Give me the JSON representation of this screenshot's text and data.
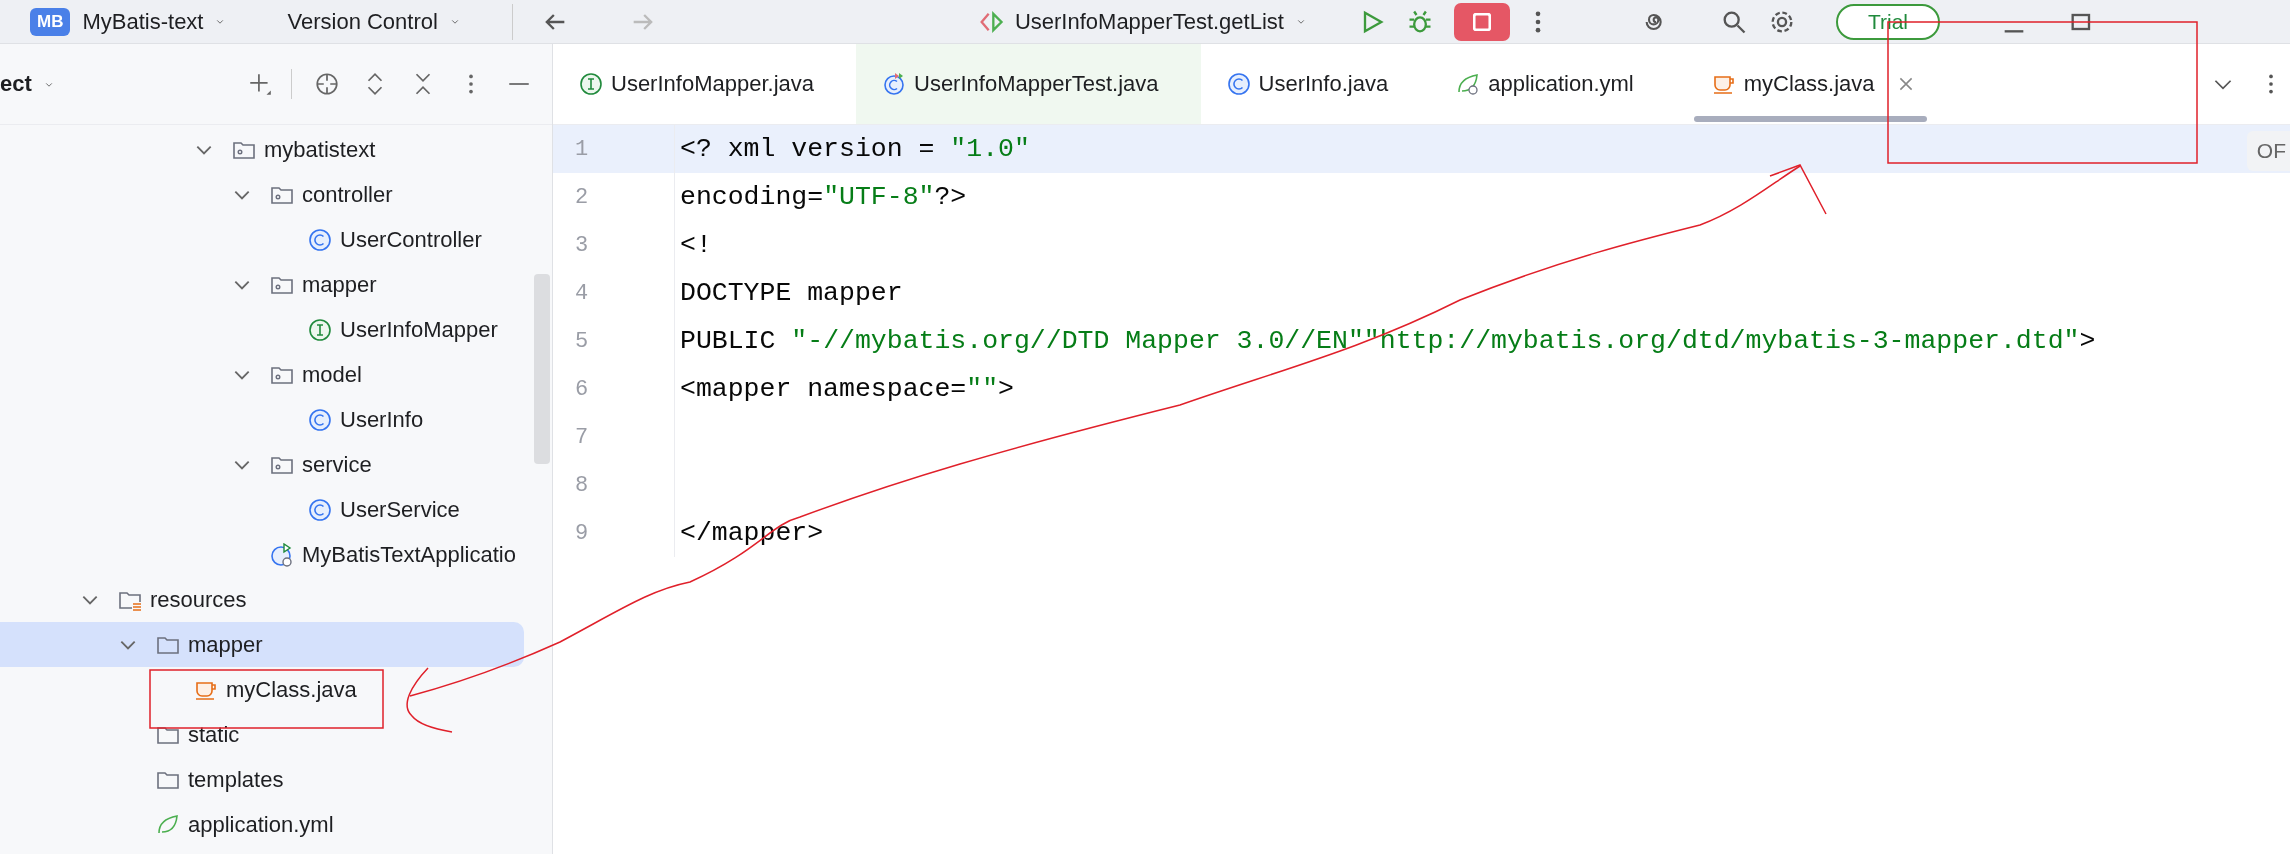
{
  "toolbar": {
    "project_badge": "MB",
    "project": "MyBatis-text",
    "vcs": "Version Control",
    "run_config": "UserInfoMapperTest.getList",
    "trial": "Trial"
  },
  "project_panel": {
    "title": "ect"
  },
  "tree": [
    {
      "label": "mybatistext",
      "kind": "package",
      "expanded": true,
      "selected": false,
      "children": [
        {
          "label": "controller",
          "kind": "package",
          "expanded": true,
          "selected": false,
          "children": [
            {
              "label": "UserController",
              "kind": "class",
              "selected": false
            }
          ]
        },
        {
          "label": "mapper",
          "kind": "package",
          "expanded": true,
          "selected": false,
          "children": [
            {
              "label": "UserInfoMapper",
              "kind": "interface",
              "selected": false
            }
          ]
        },
        {
          "label": "model",
          "kind": "package",
          "expanded": true,
          "selected": false,
          "children": [
            {
              "label": "UserInfo",
              "kind": "class",
              "selected": false
            }
          ]
        },
        {
          "label": "service",
          "kind": "package",
          "expanded": true,
          "selected": false,
          "children": [
            {
              "label": "UserService",
              "kind": "class",
              "selected": false
            }
          ]
        },
        {
          "label": "MyBatisTextApplicatio",
          "kind": "app",
          "selected": false
        }
      ]
    },
    {
      "label": "resources",
      "kind": "resources",
      "expanded": true,
      "selected": false,
      "children": [
        {
          "label": "mapper",
          "kind": "folder",
          "expanded": true,
          "selected": true,
          "children": [
            {
              "label": "myClass.java",
              "kind": "java",
              "selected": false
            }
          ]
        },
        {
          "label": "static",
          "kind": "folder",
          "selected": false
        },
        {
          "label": "templates",
          "kind": "folder",
          "selected": false
        },
        {
          "label": "application.yml",
          "kind": "yml",
          "selected": false
        }
      ]
    }
  ],
  "tabs": [
    {
      "label": "UserInfoMapper.java",
      "kind": "interface",
      "selected": false
    },
    {
      "label": "UserInfoMapperTest.java",
      "kind": "test",
      "selected": false
    },
    {
      "label": "UserInfo.java",
      "kind": "class",
      "selected": false
    },
    {
      "label": "application.yml",
      "kind": "yml",
      "selected": false
    },
    {
      "label": "myClass.java",
      "kind": "java",
      "selected": true
    }
  ],
  "editor_badge": "OF",
  "lines": [
    {
      "number": "1",
      "current": true,
      "segments": [
        {
          "text": "<? xml version = ",
          "kind": "plain"
        },
        {
          "text": "\"1.0\"",
          "kind": "string"
        }
      ]
    },
    {
      "number": "2",
      "current": false,
      "segments": [
        {
          "text": "encoding=",
          "kind": "plain"
        },
        {
          "text": "\"UTF-8\"",
          "kind": "string"
        },
        {
          "text": "?>",
          "kind": "plain"
        }
      ]
    },
    {
      "number": "3",
      "current": false,
      "segments": [
        {
          "text": "<!",
          "kind": "plain"
        }
      ]
    },
    {
      "number": "4",
      "current": false,
      "segments": [
        {
          "text": "DOCTYPE mapper",
          "kind": "plain"
        }
      ]
    },
    {
      "number": "5",
      "current": false,
      "segments": [
        {
          "text": "PUBLIC ",
          "kind": "plain"
        },
        {
          "text": "\"-//mybatis.org//DTD Mapper 3.0//EN\"",
          "kind": "string"
        },
        {
          "text": "\"http://mybatis.org/dtd/mybatis-3-mapper.dtd\"",
          "kind": "string"
        },
        {
          "text": ">",
          "kind": "plain"
        }
      ]
    },
    {
      "number": "6",
      "current": false,
      "segments": [
        {
          "text": "<mapper namespace=",
          "kind": "plain"
        },
        {
          "text": "\"\"",
          "kind": "string"
        },
        {
          "text": ">",
          "kind": "plain"
        }
      ]
    },
    {
      "number": "7",
      "current": false
    },
    {
      "number": "8",
      "current": false
    },
    {
      "number": "9",
      "current": false,
      "segments": [
        {
          "text": "</mapper>",
          "kind": "plain"
        }
      ]
    }
  ]
}
